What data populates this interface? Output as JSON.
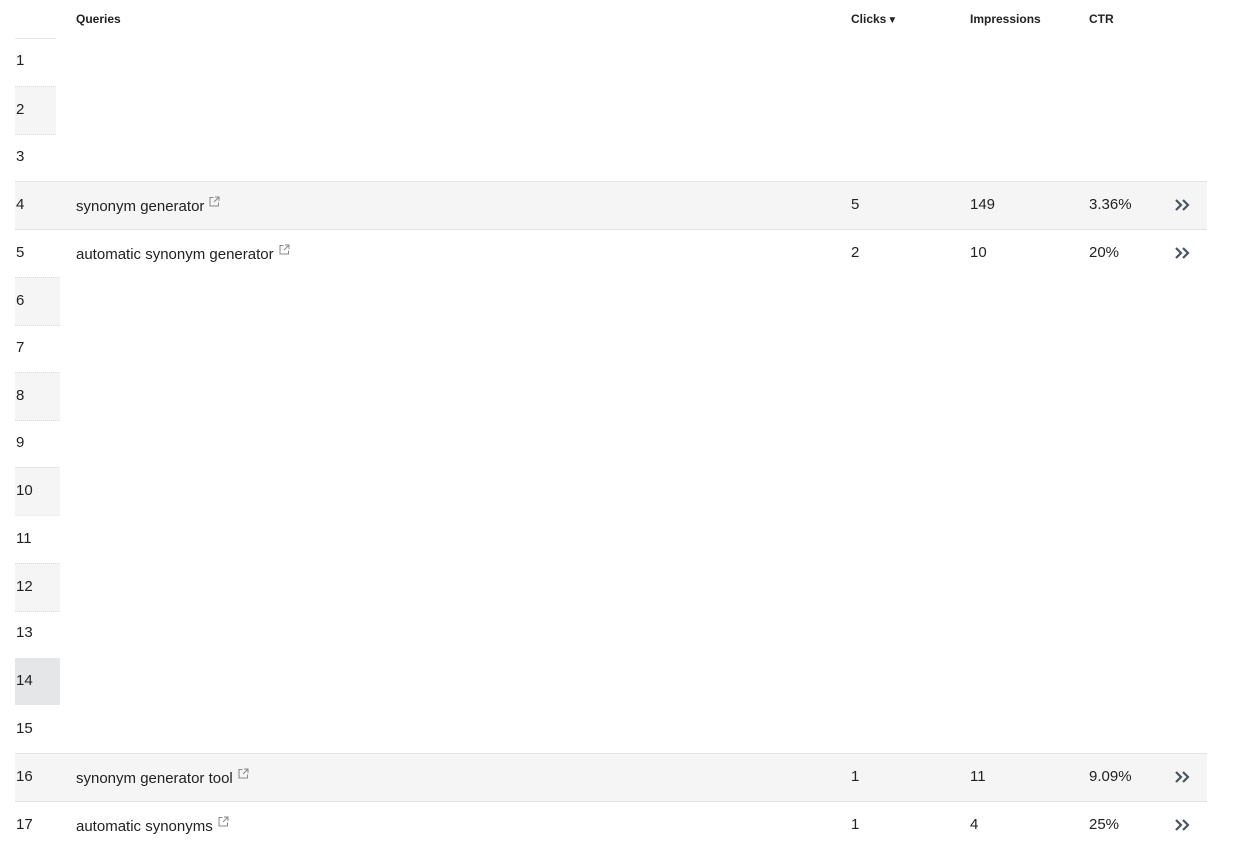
{
  "header": {
    "queries": "Queries",
    "clicks": "Clicks",
    "clicks_sort_indicator": "▼",
    "impressions": "Impressions",
    "ctr": "CTR"
  },
  "icons": {
    "external_link": "external-link-icon",
    "expand_row": "double-chevron-right-icon"
  },
  "colors": {
    "row_shade": "#f5f5f5",
    "row_shade_selected": "#e4e6e7",
    "divider": "#e2e2e2",
    "icon": "#4a5563",
    "text": "#222222"
  },
  "rows": [
    {
      "rank": "1"
    },
    {
      "rank": "2"
    },
    {
      "rank": "3"
    },
    {
      "rank": "4",
      "query": "synonym generator",
      "clicks": "5",
      "impressions": "149",
      "ctr": "3.36%"
    },
    {
      "rank": "5",
      "query": "automatic synonym generator",
      "clicks": "2",
      "impressions": "10",
      "ctr": "20%"
    },
    {
      "rank": "6"
    },
    {
      "rank": "7"
    },
    {
      "rank": "8"
    },
    {
      "rank": "9"
    },
    {
      "rank": "10"
    },
    {
      "rank": "11"
    },
    {
      "rank": "12"
    },
    {
      "rank": "13"
    },
    {
      "rank": "14"
    },
    {
      "rank": "15"
    },
    {
      "rank": "16",
      "query": "synonym generator tool",
      "clicks": "1",
      "impressions": "11",
      "ctr": "9.09%"
    },
    {
      "rank": "17",
      "query": "automatic synonyms",
      "clicks": "1",
      "impressions": "4",
      "ctr": "25%"
    }
  ]
}
